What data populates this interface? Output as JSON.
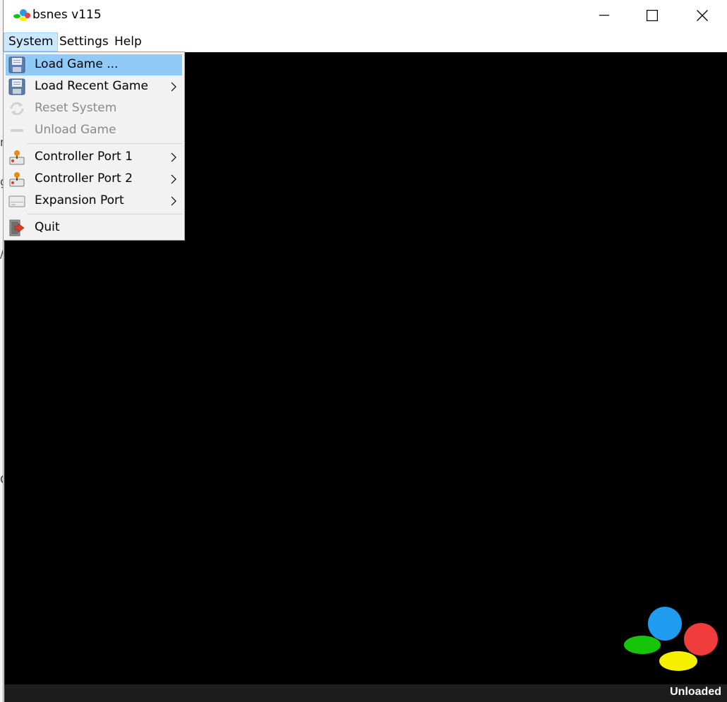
{
  "window": {
    "title": "bsnes v115",
    "controls": {
      "minimize": "minimize-icon",
      "maximize": "maximize-icon",
      "close": "close-icon"
    }
  },
  "menubar": {
    "items": [
      {
        "label": "System",
        "open": true
      },
      {
        "label": "Settings"
      },
      {
        "label": "Help"
      }
    ]
  },
  "system_menu": {
    "items": [
      {
        "label": "Load Game ...",
        "icon": "floppy-disk-icon",
        "highlighted": true
      },
      {
        "label": "Load Recent Game",
        "icon": "floppy-disk-icon",
        "submenu": true
      },
      {
        "label": "Reset System",
        "icon": "refresh-icon",
        "disabled": true
      },
      {
        "label": "Unload Game",
        "icon": "remove-icon",
        "disabled": true
      },
      {
        "label": "Controller Port 1",
        "icon": "joystick-icon",
        "submenu": true
      },
      {
        "label": "Controller Port 2",
        "icon": "joystick-icon",
        "submenu": true
      },
      {
        "label": "Expansion Port",
        "icon": "expansion-port-icon",
        "submenu": true
      },
      {
        "label": "Quit",
        "icon": "exit-icon"
      }
    ]
  },
  "status": {
    "text": "Unloaded"
  },
  "colors": {
    "menu_highlight": "#91c9f7",
    "menubar_open": "#cce8ff",
    "canvas": "#000000",
    "statusbar": "#1d1d1d",
    "logo_blue": "#1f9bf0",
    "logo_red": "#f03c3c",
    "logo_green": "#16c40a",
    "logo_yellow": "#f5f000"
  }
}
